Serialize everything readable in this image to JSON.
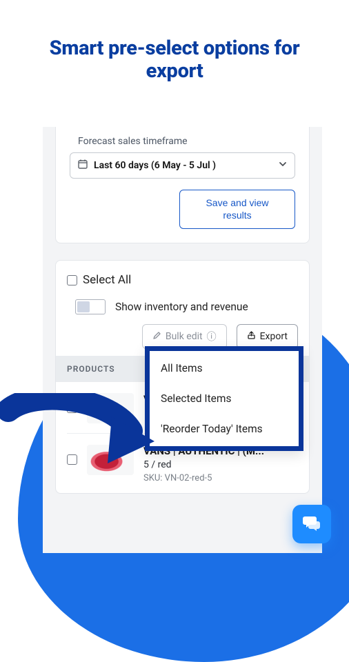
{
  "headline": "Smart pre-select options for export",
  "timeframe": {
    "label": "Forecast sales timeframe",
    "value": "Last 60 days (6 May - 5 Jul )"
  },
  "save_button": "Save and view results",
  "select_all": "Select All",
  "toggle_label": "Show inventory and revenue",
  "bulk_button": "Bulk edit",
  "export_button": "Export",
  "table_header": "PRODUCTS",
  "products": [
    {
      "title": "VANS | AUTHENTIC | (M... p |",
      "sub": "",
      "sku": ""
    },
    {
      "title": "VANS | AUTHENTIC | (M... ",
      "sub": "5 / red",
      "sku": "SKU: VN-02-red-5"
    }
  ],
  "dropdown": {
    "items": [
      "All Items",
      "Selected Items",
      "'Reorder Today' Items"
    ]
  },
  "icons": {
    "calendar": "calendar-icon",
    "chevron": "chevron-down-icon",
    "pencil": "pencil-icon",
    "export": "export-icon",
    "chat": "chat-icon",
    "arrow": "pointer-arrow"
  },
  "colors": {
    "brand": "#0a3ea0",
    "accent": "#1e8cff"
  }
}
